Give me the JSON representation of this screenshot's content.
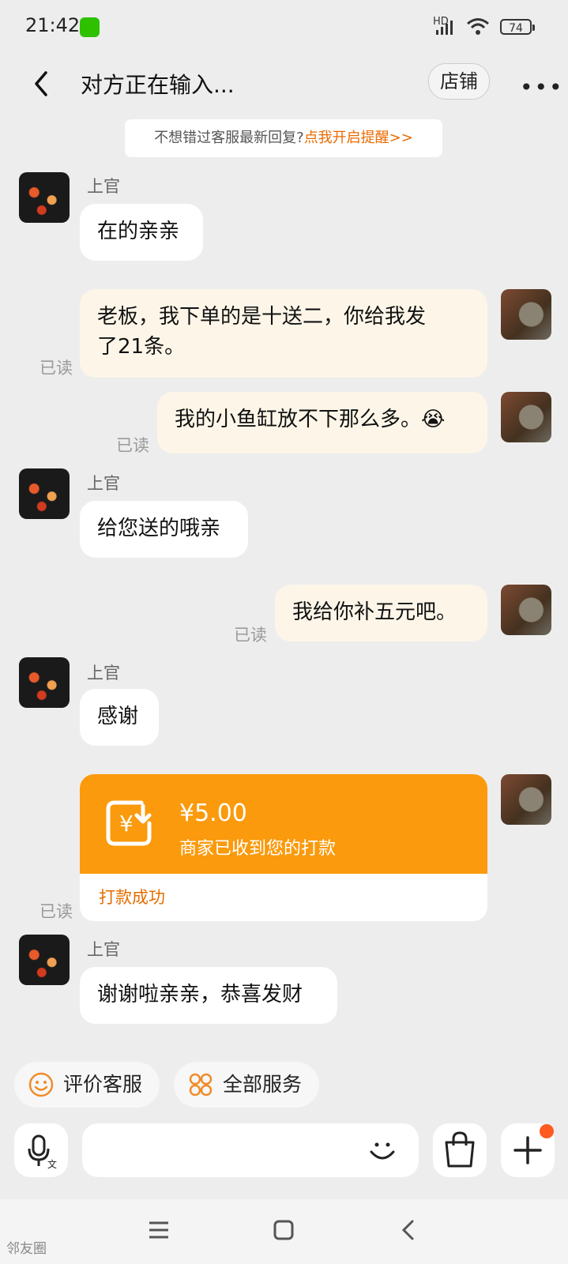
{
  "status_bar": {
    "time": "21:42",
    "network": "HD",
    "battery": "74"
  },
  "header": {
    "title": "对方正在输入...",
    "shop_button": "店铺",
    "more_label": "•••"
  },
  "notice": {
    "text": "不想错过客服最新回复?",
    "link": "点我开启提醒>>"
  },
  "messages": [
    {
      "side": "left",
      "sender": "上官",
      "text": "在的亲亲"
    },
    {
      "side": "right",
      "read": "已读",
      "text_line1": "老板，我下单的是十送二，你给我发",
      "text_line2": "了21条。"
    },
    {
      "side": "right",
      "read": "已读",
      "text": "我的小鱼缸放不下那么多。",
      "emoji": "😭"
    },
    {
      "side": "left",
      "sender": "上官",
      "text": "给您送的哦亲"
    },
    {
      "side": "right",
      "read": "已读",
      "text": "我给你补五元吧。"
    },
    {
      "side": "left",
      "sender": "上官",
      "text": "感谢"
    },
    {
      "side": "right",
      "read": "已读",
      "card": {
        "amount": "¥5.00",
        "desc": "商家已收到您的打款",
        "status": "打款成功",
        "symbol": "¥"
      }
    },
    {
      "side": "left",
      "sender": "上官",
      "text": "谢谢啦亲亲，恭喜发财"
    }
  ],
  "quick_actions": [
    {
      "label": "评价客服",
      "icon": "smile-icon"
    },
    {
      "label": "全部服务",
      "icon": "grid-icon"
    }
  ],
  "input": {
    "placeholder": ""
  },
  "watermark": "邻友圈",
  "colors": {
    "accent": "#fa9a0c",
    "link": "#e96a00",
    "badge": "#ff5a1f"
  }
}
